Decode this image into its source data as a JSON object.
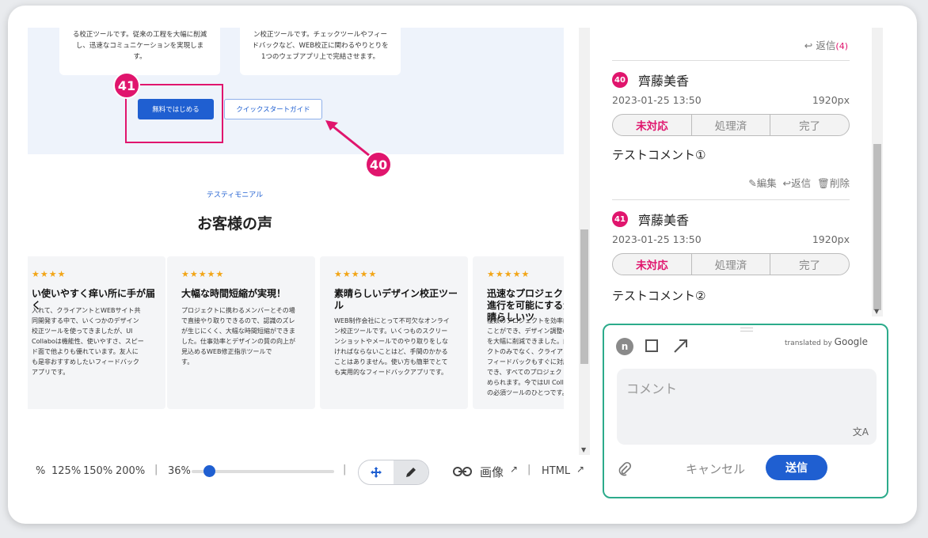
{
  "preview": {
    "feature_cards": [
      {
        "lines": [
          "る校正ツールです。従来の工程を大幅に削減",
          "し、迅速なコミュニケーションを実現しま",
          "す。"
        ]
      },
      {
        "lines": [
          "ン校正ツールです。チェックツールやフィー",
          "ドバックなど、WEB校正に関わるやりとりを",
          "1つのウェブアプリ上で完結させます。"
        ]
      }
    ],
    "primary_button": "無料ではじめる",
    "secondary_button": "クイックスタートガイド",
    "markers": {
      "m41": "41",
      "m40": "40"
    },
    "eyebrow": "テスティモニアル",
    "heading": "お客様の声",
    "testimonials": [
      {
        "stars": "★★★★",
        "title": "い使いやすく痒い所に手が届く",
        "body": [
          "入れて、クライアントとWEBサイト共",
          "同開発する中で、いくつかのデザイン",
          "校正ツールを使ってきましたが、UI",
          "Collaboは機能性、使いやすさ、スピー",
          "ド面で他よりも優れています。友人に",
          "も是非おすすめしたいフィードバック",
          "アプリです。"
        ]
      },
      {
        "stars": "★★★★★",
        "title": "大幅な時間短縮が実現！",
        "body": [
          "プロジェクトに携わるメンバーとその場",
          "で直接やり取りできるので、認識のズレ",
          "が生じにくく、大幅な時間短縮ができま",
          "した。仕事効率とデザインの質の向上が",
          "見込めるWEB修正指示ツールで",
          "す。"
        ]
      },
      {
        "stars": "★★★★★",
        "title": "素晴らしいデザイン校正ツール",
        "body": [
          "WEB制作会社にとって不可欠なオンライ",
          "ン校正ツールです。いくつものスクリー",
          "ンショットやメールでのやり取りをしな",
          "ければならないことはど、手間のかかる",
          "ことはありません。使い方も簡単でとて",
          "も実用的なフィードバックアプリです。"
        ]
      },
      {
        "stars": "★★★★★",
        "title": "迅速なプロジェクト進行を可能にする素晴らしいツ",
        "body": [
          "複数のプロジェクトを効率的に",
          "ことができ、デザイン調整の手",
          "を大幅に削減できました。内部",
          "クトのみでなく、クライアント",
          "フィードバックもすぐに対応す",
          "でき、すべてのプロジェクトが",
          "められます。今ではUI Collabo",
          "の必須ツールのひとつです。"
        ]
      }
    ]
  },
  "toolbar": {
    "zoom_presets": [
      "%",
      "125%",
      "150%",
      "200%"
    ],
    "zoom_value": "36%",
    "zoom_slider_fraction": 0.12,
    "image_label": "画像",
    "html_label": "HTML"
  },
  "comments": {
    "reply_top": "返信",
    "reply_top_count": "(4)",
    "items": [
      {
        "num": "40",
        "name": "齊藤美香",
        "date": "2023-01-25 13:50",
        "resolution": "1920px",
        "statuses": [
          "未対応",
          "処理済",
          "完了"
        ],
        "active_status": "未対応",
        "text": "テストコメント①",
        "edit": "編集",
        "reply": "返信",
        "delete": "削除"
      },
      {
        "num": "41",
        "name": "齊藤美香",
        "date": "2023-01-25 13:50",
        "resolution": "1920px",
        "statuses": [
          "未対応",
          "処理済",
          "完了"
        ],
        "active_status": "未対応",
        "text": "テストコメント②",
        "edit": "編集",
        "reply": "返信",
        "delete": "削除"
      }
    ]
  },
  "editor": {
    "avatar": "n",
    "translated_by": "translated by",
    "google": "Google",
    "placeholder": "コメント",
    "cancel": "キャンセル",
    "send": "送信"
  },
  "colors": {
    "accent": "#1f5fd1",
    "marker": "#e0156d",
    "editor_border": "#2cab8b"
  }
}
